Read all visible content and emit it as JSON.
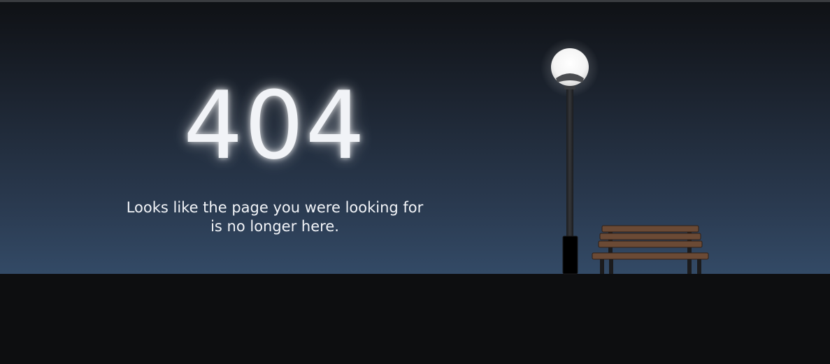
{
  "error": {
    "code": "404",
    "message_line1": "Looks like the page you were looking for",
    "message_line2": "is no longer here."
  },
  "illustration": {
    "lamp": "street-lamp",
    "bench": "park-bench"
  },
  "colors": {
    "sky_top": "#0f1115",
    "sky_bottom": "#334a66",
    "ground": "#0d0e10",
    "text": "#f1f3f7",
    "bench_wood": "#6b4a35",
    "lamp_post": "#2a2b2e"
  }
}
